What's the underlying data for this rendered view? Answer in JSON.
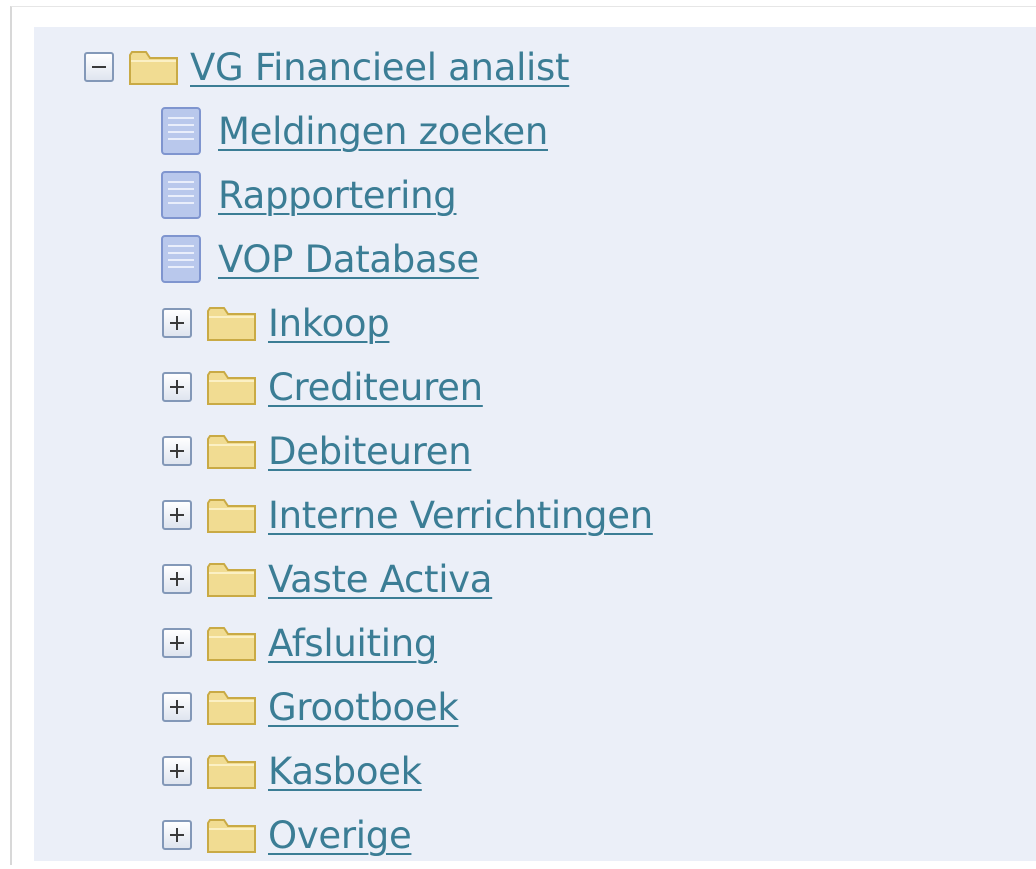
{
  "tree": {
    "root": {
      "label": "VG Financieel analist",
      "expanded": true,
      "toggle_icon": "collapse-minus-icon",
      "folder_icon": "folder-icon"
    },
    "documents": [
      {
        "label": "Meldingen zoeken",
        "icon": "document-icon"
      },
      {
        "label": "Rapportering",
        "icon": "document-icon"
      },
      {
        "label": "VOP Database",
        "icon": "document-icon"
      }
    ],
    "folders": [
      {
        "label": "Inkoop",
        "expanded": false
      },
      {
        "label": "Crediteuren",
        "expanded": false
      },
      {
        "label": "Debiteuren",
        "expanded": false
      },
      {
        "label": "Interne Verrichtingen",
        "expanded": false
      },
      {
        "label": "Vaste Activa",
        "expanded": false
      },
      {
        "label": "Afsluiting",
        "expanded": false
      },
      {
        "label": "Grootboek",
        "expanded": false
      },
      {
        "label": "Kasboek",
        "expanded": false
      },
      {
        "label": "Overige",
        "expanded": false
      }
    ]
  },
  "colors": {
    "panel_background": "#ebeff8",
    "link": "#3b7d95",
    "folder_fill": "#f1dc92",
    "document_fill": "#b9c8ec"
  }
}
